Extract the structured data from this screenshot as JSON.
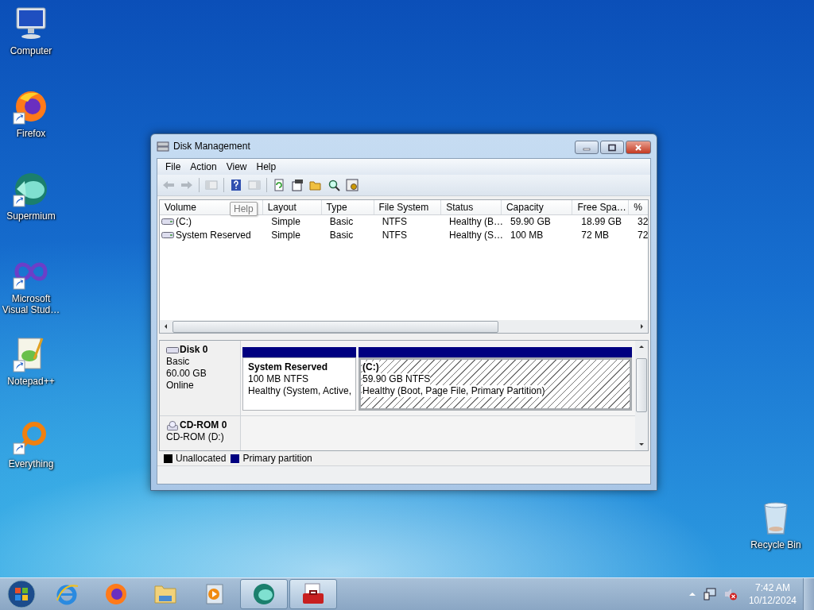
{
  "desktop_icons": [
    {
      "label": "Computer",
      "kind": "computer",
      "shortcut": false
    },
    {
      "label": "Firefox",
      "kind": "firefox",
      "shortcut": true
    },
    {
      "label": "Supermium",
      "kind": "supermium",
      "shortcut": true
    },
    {
      "label": "Microsoft Visual Stud…",
      "kind": "vs",
      "shortcut": true
    },
    {
      "label": "Notepad++",
      "kind": "notepad",
      "shortcut": true
    },
    {
      "label": "Everything",
      "kind": "everything",
      "shortcut": true
    }
  ],
  "recycle_bin": {
    "label": "Recycle Bin"
  },
  "window": {
    "title": "Disk Management",
    "menu": [
      "File",
      "Action",
      "View",
      "Help"
    ],
    "toolbar": [
      {
        "kind": "back",
        "disabled": true
      },
      {
        "kind": "forward",
        "disabled": true
      },
      {
        "kind": "sep"
      },
      {
        "kind": "console",
        "disabled": true
      },
      {
        "kind": "sep"
      },
      {
        "kind": "help",
        "disabled": false
      },
      {
        "kind": "pane",
        "disabled": true
      },
      {
        "kind": "sep"
      },
      {
        "kind": "refresh",
        "disabled": false
      },
      {
        "kind": "properties",
        "disabled": false
      },
      {
        "kind": "open",
        "disabled": false
      },
      {
        "kind": "rescan",
        "disabled": false
      },
      {
        "kind": "settings",
        "disabled": false
      }
    ],
    "tooltip": "Help",
    "volume_table": {
      "columns": [
        "Volume",
        "Layout",
        "Type",
        "File System",
        "Status",
        "Capacity",
        "Free Spa…",
        "%"
      ],
      "rows": [
        {
          "cells": [
            "(C:)",
            "Simple",
            "Basic",
            "NTFS",
            "Healthy (B…",
            "59.90 GB",
            "18.99 GB",
            "32"
          ]
        },
        {
          "cells": [
            "System Reserved",
            "Simple",
            "Basic",
            "NTFS",
            "Healthy (S…",
            "100 MB",
            "72 MB",
            "72"
          ]
        }
      ]
    },
    "disks": [
      {
        "name": "Disk 0",
        "kind": "disk",
        "lines": [
          "Basic",
          "60.00 GB",
          "Online"
        ],
        "partitions": [
          {
            "name": "System Reserved",
            "size": "100 MB NTFS",
            "status": "Healthy (System, Active,",
            "color": "#000080",
            "selected": false
          },
          {
            "name": "(C:)",
            "size": "59.90 GB NTFS",
            "status": "Healthy (Boot, Page File, Primary Partition)",
            "color": "#000080",
            "selected": true
          }
        ]
      },
      {
        "name": "CD-ROM 0",
        "kind": "cdrom",
        "lines": [
          "CD-ROM (D:)"
        ]
      }
    ],
    "legend": [
      {
        "label": "Unallocated",
        "color": "#000000"
      },
      {
        "label": "Primary partition",
        "color": "#000080"
      }
    ]
  },
  "taskbar": {
    "apps": [
      {
        "kind": "ie",
        "running": false
      },
      {
        "kind": "firefox",
        "running": false
      },
      {
        "kind": "explorer",
        "running": false
      },
      {
        "kind": "media",
        "running": false
      },
      {
        "kind": "supermium",
        "running": true
      },
      {
        "kind": "diskmgmt",
        "running": true
      }
    ],
    "clock": {
      "time": "7:42 AM",
      "date": "10/12/2024"
    }
  }
}
